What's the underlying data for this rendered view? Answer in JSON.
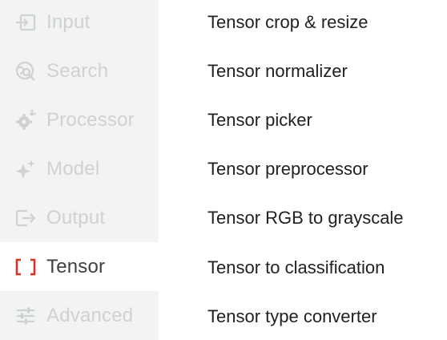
{
  "sidebar": {
    "items": [
      {
        "label": "Input",
        "icon": "input-icon",
        "active": false
      },
      {
        "label": "Search",
        "icon": "search-icon",
        "active": false
      },
      {
        "label": "Processor",
        "icon": "gear-icon",
        "active": false
      },
      {
        "label": "Model",
        "icon": "sparkle-icon",
        "active": false
      },
      {
        "label": "Output",
        "icon": "output-icon",
        "active": false
      },
      {
        "label": "Tensor",
        "icon": "brackets-icon",
        "active": true
      },
      {
        "label": "Advanced",
        "icon": "sliders-icon",
        "active": false
      }
    ]
  },
  "list": {
    "items": [
      "Tensor crop & resize",
      "Tensor normalizer",
      "Tensor picker",
      "Tensor preprocessor",
      "Tensor RGB to grayscale",
      "Tensor to classification",
      "Tensor type converter"
    ]
  },
  "colors": {
    "sidebar_bg": "#f1f3f4",
    "inactive": "#cfd1d3",
    "active_text": "#3c4043",
    "accent": "#d93025"
  }
}
